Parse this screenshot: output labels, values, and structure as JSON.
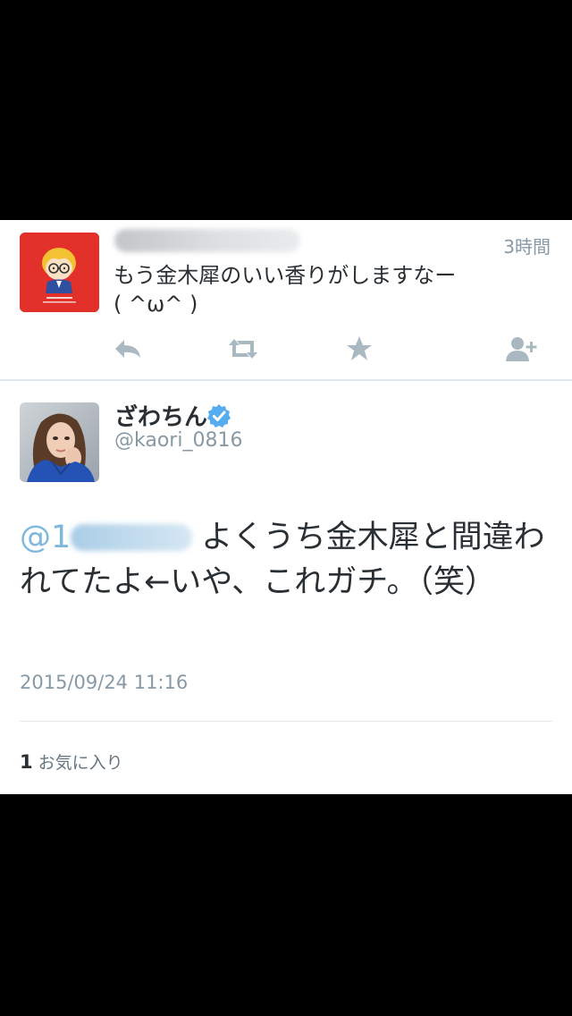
{
  "quoted_tweet": {
    "time": "3時間",
    "text": "もう金木犀のいい香りがしますなー\n( ^ω^ )",
    "actions": [
      {
        "name": "reply-icon"
      },
      {
        "name": "retweet-icon"
      },
      {
        "name": "favorite-star-icon"
      },
      {
        "name": "follow-user-icon"
      }
    ]
  },
  "main_tweet": {
    "display_name": "ざわちん",
    "handle": "@kaori_0816",
    "mention_prefix": "@1",
    "text": "よくうち金木犀と間違われてたよ←いや、これガチ。（笑）",
    "timestamp": "2015/09/24 11:16",
    "favorite_count": "1",
    "favorite_label": "お気に入り"
  },
  "colors": {
    "avatar_red": "#e2302a",
    "verified_blue": "#55acee",
    "mention_blue": "#7fb8dc",
    "muted_gray": "#8899a6"
  }
}
